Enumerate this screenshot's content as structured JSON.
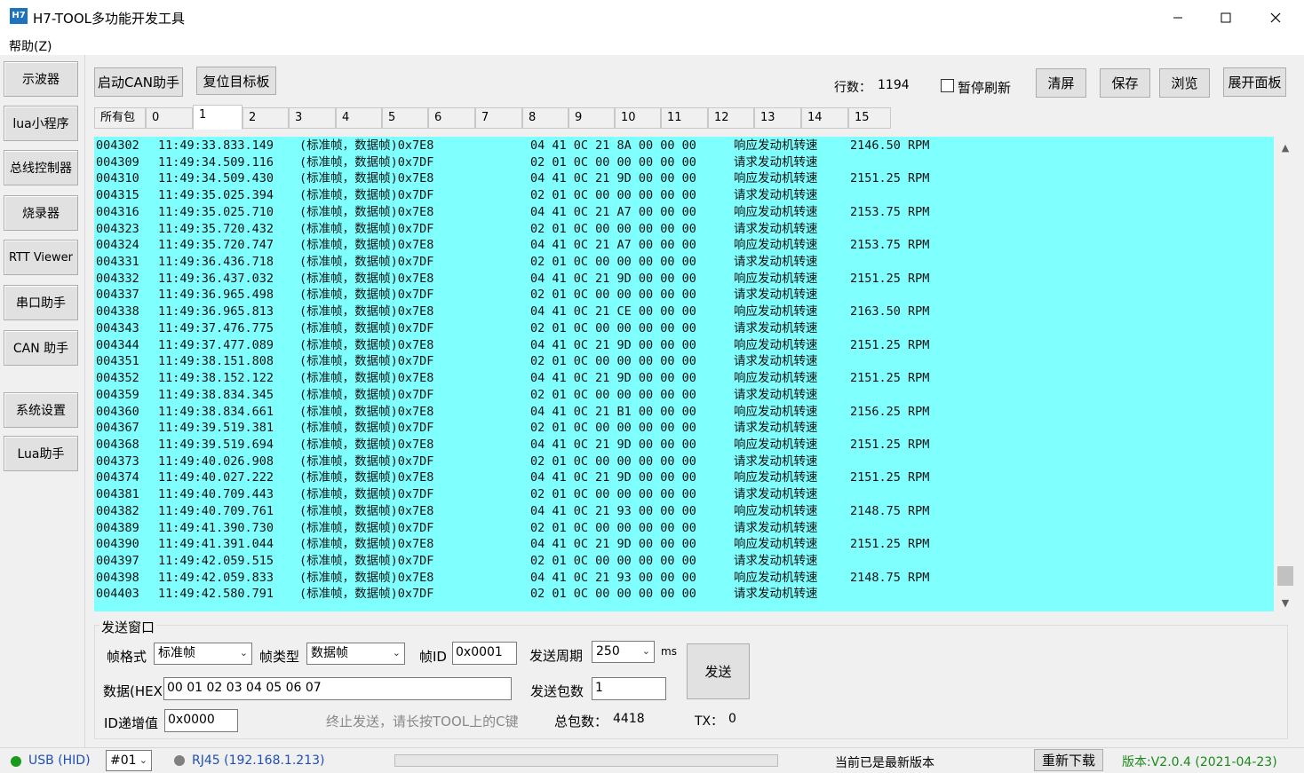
{
  "window": {
    "icon_text": "H7",
    "title": "H7-TOOL多功能开发工具"
  },
  "menu": {
    "help": "帮助(Z)"
  },
  "sidebar": {
    "items": [
      {
        "label": "示波器"
      },
      {
        "label": "lua小程序"
      },
      {
        "label": "总线控制器"
      },
      {
        "label": "烧录器"
      },
      {
        "label": "RTT Viewer"
      },
      {
        "label": "串口助手"
      },
      {
        "label": "CAN 助手"
      },
      {
        "label": "系统设置"
      },
      {
        "label": "Lua助手"
      }
    ]
  },
  "toolbar": {
    "start_can": "启动CAN助手",
    "reset_target": "复位目标板",
    "row_count_label": "行数：",
    "row_count": "1194",
    "pause_refresh": "暂停刷新",
    "clear": "清屏",
    "save": "保存",
    "browse": "浏览",
    "expand_panel": "展开面板"
  },
  "tabs": [
    "所有包",
    "0",
    "1",
    "2",
    "3",
    "4",
    "5",
    "6",
    "7",
    "8",
    "9",
    "10",
    "11",
    "12",
    "13",
    "14",
    "15"
  ],
  "active_tab": "1",
  "log": {
    "rows": [
      [
        "004302",
        "11:49:33.833.149",
        "(标准帧，数据帧)0x7E8",
        "04 41 0C 21 8A 00 00 00",
        "响应发动机转速",
        "2146.50 RPM"
      ],
      [
        "004309",
        "11:49:34.509.116",
        "(标准帧，数据帧)0x7DF",
        "02 01 0C 00 00 00 00 00",
        "请求发动机转速",
        ""
      ],
      [
        "004310",
        "11:49:34.509.430",
        "(标准帧，数据帧)0x7E8",
        "04 41 0C 21 9D 00 00 00",
        "响应发动机转速",
        "2151.25 RPM"
      ],
      [
        "004315",
        "11:49:35.025.394",
        "(标准帧，数据帧)0x7DF",
        "02 01 0C 00 00 00 00 00",
        "请求发动机转速",
        ""
      ],
      [
        "004316",
        "11:49:35.025.710",
        "(标准帧，数据帧)0x7E8",
        "04 41 0C 21 A7 00 00 00",
        "响应发动机转速",
        "2153.75 RPM"
      ],
      [
        "004323",
        "11:49:35.720.432",
        "(标准帧，数据帧)0x7DF",
        "02 01 0C 00 00 00 00 00",
        "请求发动机转速",
        ""
      ],
      [
        "004324",
        "11:49:35.720.747",
        "(标准帧，数据帧)0x7E8",
        "04 41 0C 21 A7 00 00 00",
        "响应发动机转速",
        "2153.75 RPM"
      ],
      [
        "004331",
        "11:49:36.436.718",
        "(标准帧，数据帧)0x7DF",
        "02 01 0C 00 00 00 00 00",
        "请求发动机转速",
        ""
      ],
      [
        "004332",
        "11:49:36.437.032",
        "(标准帧，数据帧)0x7E8",
        "04 41 0C 21 9D 00 00 00",
        "响应发动机转速",
        "2151.25 RPM"
      ],
      [
        "004337",
        "11:49:36.965.498",
        "(标准帧，数据帧)0x7DF",
        "02 01 0C 00 00 00 00 00",
        "请求发动机转速",
        ""
      ],
      [
        "004338",
        "11:49:36.965.813",
        "(标准帧，数据帧)0x7E8",
        "04 41 0C 21 CE 00 00 00",
        "响应发动机转速",
        "2163.50 RPM"
      ],
      [
        "004343",
        "11:49:37.476.775",
        "(标准帧，数据帧)0x7DF",
        "02 01 0C 00 00 00 00 00",
        "请求发动机转速",
        ""
      ],
      [
        "004344",
        "11:49:37.477.089",
        "(标准帧，数据帧)0x7E8",
        "04 41 0C 21 9D 00 00 00",
        "响应发动机转速",
        "2151.25 RPM"
      ],
      [
        "004351",
        "11:49:38.151.808",
        "(标准帧，数据帧)0x7DF",
        "02 01 0C 00 00 00 00 00",
        "请求发动机转速",
        ""
      ],
      [
        "004352",
        "11:49:38.152.122",
        "(标准帧，数据帧)0x7E8",
        "04 41 0C 21 9D 00 00 00",
        "响应发动机转速",
        "2151.25 RPM"
      ],
      [
        "004359",
        "11:49:38.834.345",
        "(标准帧，数据帧)0x7DF",
        "02 01 0C 00 00 00 00 00",
        "请求发动机转速",
        ""
      ],
      [
        "004360",
        "11:49:38.834.661",
        "(标准帧，数据帧)0x7E8",
        "04 41 0C 21 B1 00 00 00",
        "响应发动机转速",
        "2156.25 RPM"
      ],
      [
        "004367",
        "11:49:39.519.381",
        "(标准帧，数据帧)0x7DF",
        "02 01 0C 00 00 00 00 00",
        "请求发动机转速",
        ""
      ],
      [
        "004368",
        "11:49:39.519.694",
        "(标准帧，数据帧)0x7E8",
        "04 41 0C 21 9D 00 00 00",
        "响应发动机转速",
        "2151.25 RPM"
      ],
      [
        "004373",
        "11:49:40.026.908",
        "(标准帧，数据帧)0x7DF",
        "02 01 0C 00 00 00 00 00",
        "请求发动机转速",
        ""
      ],
      [
        "004374",
        "11:49:40.027.222",
        "(标准帧，数据帧)0x7E8",
        "04 41 0C 21 9D 00 00 00",
        "响应发动机转速",
        "2151.25 RPM"
      ],
      [
        "004381",
        "11:49:40.709.443",
        "(标准帧，数据帧)0x7DF",
        "02 01 0C 00 00 00 00 00",
        "请求发动机转速",
        ""
      ],
      [
        "004382",
        "11:49:40.709.761",
        "(标准帧，数据帧)0x7E8",
        "04 41 0C 21 93 00 00 00",
        "响应发动机转速",
        "2148.75 RPM"
      ],
      [
        "004389",
        "11:49:41.390.730",
        "(标准帧，数据帧)0x7DF",
        "02 01 0C 00 00 00 00 00",
        "请求发动机转速",
        ""
      ],
      [
        "004390",
        "11:49:41.391.044",
        "(标准帧，数据帧)0x7E8",
        "04 41 0C 21 9D 00 00 00",
        "响应发动机转速",
        "2151.25 RPM"
      ],
      [
        "004397",
        "11:49:42.059.515",
        "(标准帧，数据帧)0x7DF",
        "02 01 0C 00 00 00 00 00",
        "请求发动机转速",
        ""
      ],
      [
        "004398",
        "11:49:42.059.833",
        "(标准帧，数据帧)0x7E8",
        "04 41 0C 21 93 00 00 00",
        "响应发动机转速",
        "2148.75 RPM"
      ],
      [
        "004403",
        "11:49:42.580.791",
        "(标准帧，数据帧)0x7DF",
        "02 01 0C 00 00 00 00 00",
        "请求发动机转速",
        ""
      ]
    ]
  },
  "send": {
    "group_title": "发送窗口",
    "frame_format_label": "帧格式",
    "frame_format_value": "标准帧",
    "frame_type_label": "帧类型",
    "frame_type_value": "数据帧",
    "frame_id_label": "帧ID",
    "frame_id_value": "0x0001",
    "period_label": "发送周期",
    "period_value": "250",
    "period_unit": "ms",
    "send_button": "发送",
    "data_label": "数据(HEX)",
    "data_value": "00 01 02 03 04 05 06 07",
    "count_label": "发送包数",
    "count_value": "1",
    "id_inc_label": "ID递增值",
    "id_inc_value": "0x0000",
    "hint": "终止发送，请长按TOOL上的C键",
    "total_label": "总包数：",
    "total_value": "4418",
    "tx_label": "TX：",
    "tx_value": "0"
  },
  "status": {
    "usb": "USB (HID)",
    "device_index": "#01",
    "rj45": "RJ45 (192.168.1.213)",
    "progress": 0,
    "update_msg": "当前已是最新版本",
    "redownload": "重新下载",
    "version": "版本:V2.0.4 (2021-04-23)",
    "colors": {
      "usb_dot": "#1a9a1a",
      "rj45_dot": "#808080",
      "version_text": "#1a8a1a",
      "link_text": "#1e4fb4",
      "log_bg": "#80ffff"
    }
  }
}
